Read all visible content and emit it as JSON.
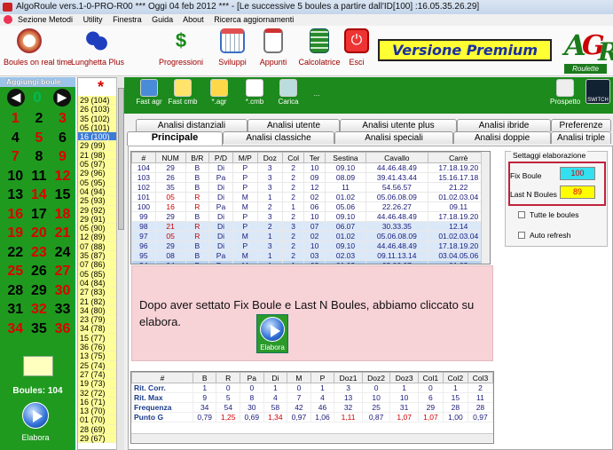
{
  "window": {
    "title": "AlgoRoule vers.1-0-PRO-R00  ***  Oggi 04 feb 2012  ***  - [Le successive 5 boules a partire dall'ID[100] :16.05.35.26.29]"
  },
  "menu": [
    "Sezione Metodi",
    "Utility",
    "Finestra",
    "Guida",
    "About",
    "Ricerca aggiornamenti"
  ],
  "toolbar": [
    {
      "label": "Boules on real time",
      "icon": "clock-icon"
    },
    {
      "label": "Lunghetta Plus",
      "icon": "lottery-balls-icon"
    },
    {
      "label": "Progressioni",
      "icon": "dollar-icon"
    },
    {
      "label": "Sviluppi",
      "icon": "calendar-icon"
    },
    {
      "label": "Appunti",
      "icon": "clipboard-icon"
    },
    {
      "label": "Calcolatrice",
      "icon": "calculator-icon"
    },
    {
      "label": "Esci",
      "icon": "exit-icon"
    }
  ],
  "premium": "Versione Premium",
  "logo": {
    "a": "A",
    "g": "G",
    "r": "R",
    "sub": "Roulette"
  },
  "left": {
    "header": "Aggiungi boule",
    "zero": "0",
    "arrow_left": "◀",
    "arrow_right": "▶",
    "numbers": [
      [
        "1",
        "2",
        "3"
      ],
      [
        "4",
        "5",
        "6"
      ],
      [
        "7",
        "8",
        "9"
      ],
      [
        "10",
        "11",
        "12"
      ],
      [
        "13",
        "14",
        "15"
      ],
      [
        "16",
        "17",
        "18"
      ],
      [
        "19",
        "20",
        "21"
      ],
      [
        "22",
        "23",
        "24"
      ],
      [
        "25",
        "26",
        "27"
      ],
      [
        "28",
        "29",
        "30"
      ],
      [
        "31",
        "32",
        "33"
      ],
      [
        "34",
        "35",
        "36"
      ]
    ],
    "colors": [
      [
        "r",
        "k",
        "r"
      ],
      [
        "k",
        "r",
        "k"
      ],
      [
        "r",
        "k",
        "r"
      ],
      [
        "k",
        "k",
        "r"
      ],
      [
        "k",
        "r",
        "k"
      ],
      [
        "r",
        "k",
        "r"
      ],
      [
        "r",
        "r",
        "r"
      ],
      [
        "k",
        "r",
        "k"
      ],
      [
        "r",
        "k",
        "r"
      ],
      [
        "k",
        "k",
        "r"
      ],
      [
        "k",
        "r",
        "k"
      ],
      [
        "r",
        "k",
        "r"
      ]
    ],
    "boules_label": "Boules: 104",
    "elabora_label": "Elabora"
  },
  "history": {
    "star": "*",
    "items": [
      "29 (104)",
      "26 (103)",
      "35 (102)",
      "05 (101)",
      "16 (100)",
      "29 (99)",
      "21 (98)",
      "05 (97)",
      "29 (96)",
      "05 (95)",
      "04 (94)",
      "25 (93)",
      "29 (92)",
      "29 (91)",
      "05 (90)",
      "12 (89)",
      "07 (88)",
      "35 (87)",
      "07 (86)",
      "05 (85)",
      "04 (84)",
      "27 (83)",
      "21 (82)",
      "34 (80)",
      "23 (79)",
      "34 (78)",
      "15 (77)",
      "36 (76)",
      "13 (75)",
      "25 (74)",
      "27 (74)",
      "19 (73)",
      "32 (72)",
      "16 (71)",
      "13 (70)",
      "01 (70)",
      "28 (69)",
      "29 (67)"
    ],
    "selected_index": 4
  },
  "greenbar": [
    {
      "label": "Fast agr",
      "icon": "save-icon"
    },
    {
      "label": "Fast cmb",
      "icon": "save-star-icon"
    },
    {
      "label": "*.agr",
      "icon": "file-open-icon"
    },
    {
      "label": "*.cmb",
      "icon": "file-stack-icon"
    },
    {
      "label": "Carica",
      "icon": "robot-icon"
    },
    {
      "label": "...",
      "icon": ""
    },
    {
      "label": "Prospetto",
      "icon": "html-icon"
    },
    {
      "label": "SWITCH",
      "icon": "switch-icon"
    }
  ],
  "tabs_row1": [
    "Analisi distanziali",
    "Analisi utente",
    "Analisi utente plus",
    "Analisi ibride",
    "Preferenze"
  ],
  "tabs_row2": [
    "Principale",
    "Analisi classiche",
    "Analisi speciali",
    "Analisi doppie",
    "Analisi triple"
  ],
  "main_table": {
    "headers": [
      "#",
      "NUM",
      "B/R",
      "P/D",
      "M/P",
      "Doz",
      "Col",
      "Ter",
      "Sestina",
      "Cavallo",
      "Carrè"
    ],
    "rows": [
      [
        "104",
        "29",
        "B",
        "Di",
        "P",
        "3",
        "2",
        "10",
        "09.10",
        "44.46.48.49",
        "17.18.19.20"
      ],
      [
        "103",
        "26",
        "B",
        "Pa",
        "P",
        "3",
        "2",
        "09",
        "08.09",
        "39.41.43.44",
        "15.16.17.18"
      ],
      [
        "102",
        "35",
        "B",
        "Di",
        "P",
        "3",
        "2",
        "12",
        "11",
        "54.56.57",
        "21.22"
      ],
      [
        "101",
        "05",
        "R",
        "Di",
        "M",
        "1",
        "2",
        "02",
        "01.02",
        "05.06.08.09",
        "01.02.03.04"
      ],
      [
        "100",
        "16",
        "R",
        "Pa",
        "M",
        "2",
        "1",
        "06",
        "05.06",
        "22.26.27",
        "09.11"
      ],
      [
        "99",
        "29",
        "B",
        "Di",
        "P",
        "3",
        "2",
        "10",
        "09.10",
        "44.46.48.49",
        "17.18.19.20"
      ],
      [
        "98",
        "21",
        "R",
        "Di",
        "P",
        "2",
        "3",
        "07",
        "06.07",
        "30.33.35",
        "12.14"
      ],
      [
        "97",
        "05",
        "R",
        "Di",
        "M",
        "1",
        "2",
        "02",
        "01.02",
        "05.06.08.09",
        "01.02.03.04"
      ],
      [
        "96",
        "29",
        "B",
        "Di",
        "P",
        "3",
        "2",
        "10",
        "09.10",
        "44.46.48.49",
        "17.18.19.20"
      ],
      [
        "95",
        "08",
        "B",
        "Pa",
        "M",
        "1",
        "2",
        "03",
        "02.03",
        "09.11.13.14",
        "03.04.05.06"
      ],
      [
        "94",
        "04",
        "B",
        "Pa",
        "M",
        "1",
        "1",
        "02",
        "01.02",
        "03.06.07",
        "01.03"
      ]
    ],
    "red_rows": [
      3,
      4,
      6,
      7
    ]
  },
  "pink_note": "Dopo aver settato Fix Boule e Last N Boules, abbiamo cliccato su elabora.",
  "elabora_center": "Elabora",
  "bottom_table": {
    "headers": [
      "#",
      "B",
      "R",
      "Pa",
      "Di",
      "M",
      "P",
      "Doz1",
      "Doz2",
      "Doz3",
      "Col1",
      "Col2",
      "Col3"
    ],
    "rows": [
      [
        "Rit. Corr.",
        "1",
        "0",
        "0",
        "1",
        "0",
        "1",
        "3",
        "0",
        "1",
        "0",
        "1",
        "2"
      ],
      [
        "Rit. Max",
        "9",
        "5",
        "8",
        "4",
        "7",
        "4",
        "13",
        "10",
        "10",
        "6",
        "15",
        "11"
      ],
      [
        "Frequenza",
        "34",
        "54",
        "30",
        "58",
        "42",
        "46",
        "32",
        "25",
        "31",
        "29",
        "28",
        "28"
      ],
      [
        "Punto G",
        "0,79",
        "1,25",
        "0,69",
        "1,34",
        "0,97",
        "1,06",
        "1,11",
        "0,87",
        "1,07",
        "1,07",
        "1,00",
        "0,97"
      ]
    ],
    "red_cells_row3": [
      2,
      4,
      7,
      9,
      10
    ]
  },
  "settings": {
    "legend": "Settaggi elaborazione",
    "fix_label": "Fix Boule",
    "fix_value": "100",
    "last_label": "Last N Boules",
    "last_value": "89",
    "tutte": "Tutte le boules",
    "auto": "Auto refresh",
    "colors": {
      "fix_bg": "#33e0f0",
      "last_bg": "#ffff00",
      "highlight": "#c0223c"
    }
  }
}
